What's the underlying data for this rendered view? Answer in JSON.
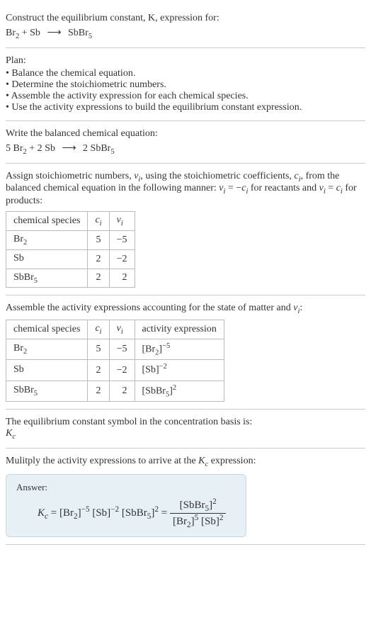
{
  "intro": {
    "line1": "Construct the equilibrium constant, K, expression for:",
    "equation_lhs": "Br",
    "equation_lhs_sub": "2",
    "equation_plus": " + Sb ",
    "equation_rhs": " SbBr",
    "equation_rhs_sub": "5"
  },
  "plan": {
    "title": "Plan:",
    "items": [
      "Balance the chemical equation.",
      "Determine the stoichiometric numbers.",
      "Assemble the activity expression for each chemical species.",
      "Use the activity expressions to build the equilibrium constant expression."
    ]
  },
  "balanced": {
    "title": "Write the balanced chemical equation:",
    "lhs1_coef": "5 ",
    "lhs1": "Br",
    "lhs1_sub": "2",
    "plus1": " + ",
    "lhs2_coef": "2 ",
    "lhs2": "Sb ",
    "rhs_coef": " 2 ",
    "rhs": "SbBr",
    "rhs_sub": "5"
  },
  "stoich": {
    "intro_a": "Assign stoichiometric numbers, ",
    "nu": "ν",
    "i": "i",
    "intro_b": ", using the stoichiometric coefficients, ",
    "c": "c",
    "intro_c": ", from the balanced chemical equation in the following manner: ",
    "eq1": " = −",
    "intro_d": " for reactants and ",
    "eq2": " = ",
    "intro_e": " for products:",
    "headers": {
      "species": "chemical species",
      "ci": "c",
      "nui": "ν"
    },
    "rows": [
      {
        "species_base": "Br",
        "species_sub": "2",
        "ci": "5",
        "nui": "−5"
      },
      {
        "species_base": "Sb",
        "species_sub": "",
        "ci": "2",
        "nui": "−2"
      },
      {
        "species_base": "SbBr",
        "species_sub": "5",
        "ci": "2",
        "nui": "2"
      }
    ]
  },
  "activity": {
    "intro": "Assemble the activity expressions accounting for the state of matter and ",
    "colon": ":",
    "headers": {
      "species": "chemical species",
      "ci": "c",
      "nui": "ν",
      "activity": "activity expression"
    },
    "rows": [
      {
        "species_base": "Br",
        "species_sub": "2",
        "ci": "5",
        "nui": "−5",
        "act_base": "[Br",
        "act_sub": "2",
        "act_close": "]",
        "act_sup": "−5"
      },
      {
        "species_base": "Sb",
        "species_sub": "",
        "ci": "2",
        "nui": "−2",
        "act_base": "[Sb",
        "act_sub": "",
        "act_close": "]",
        "act_sup": "−2"
      },
      {
        "species_base": "SbBr",
        "species_sub": "5",
        "ci": "2",
        "nui": "2",
        "act_base": "[SbBr",
        "act_sub": "5",
        "act_close": "]",
        "act_sup": "2"
      }
    ]
  },
  "kc_symbol": {
    "text": "The equilibrium constant symbol in the concentration basis is:",
    "symbol_base": "K",
    "symbol_sub": "c"
  },
  "multiply": {
    "text_a": "Mulitply the activity expressions to arrive at the ",
    "text_b": " expression:"
  },
  "answer": {
    "label": "Answer:",
    "lhs_k": "K",
    "lhs_sub": "c",
    "eq": " = ",
    "t1_base": "[Br",
    "t1_sub": "2",
    "t1_close": "]",
    "t1_sup": "−5",
    "t2_base": " [Sb]",
    "t2_sup": "−2",
    "t3_base": " [SbBr",
    "t3_sub": "5",
    "t3_close": "]",
    "t3_sup": "2",
    "eq2": " = ",
    "num_base": "[SbBr",
    "num_sub": "5",
    "num_close": "]",
    "num_sup": "2",
    "den1_base": "[Br",
    "den1_sub": "2",
    "den1_close": "]",
    "den1_sup": "5",
    "den2_base": " [Sb]",
    "den2_sup": "2"
  },
  "chart_data": {
    "type": "table",
    "tables": [
      {
        "title": "Stoichiometric numbers",
        "columns": [
          "chemical species",
          "c_i",
          "ν_i"
        ],
        "rows": [
          [
            "Br2",
            5,
            -5
          ],
          [
            "Sb",
            2,
            -2
          ],
          [
            "SbBr5",
            2,
            2
          ]
        ]
      },
      {
        "title": "Activity expressions",
        "columns": [
          "chemical species",
          "c_i",
          "ν_i",
          "activity expression"
        ],
        "rows": [
          [
            "Br2",
            5,
            -5,
            "[Br2]^-5"
          ],
          [
            "Sb",
            2,
            -2,
            "[Sb]^-2"
          ],
          [
            "SbBr5",
            2,
            2,
            "[SbBr5]^2"
          ]
        ]
      }
    ]
  }
}
